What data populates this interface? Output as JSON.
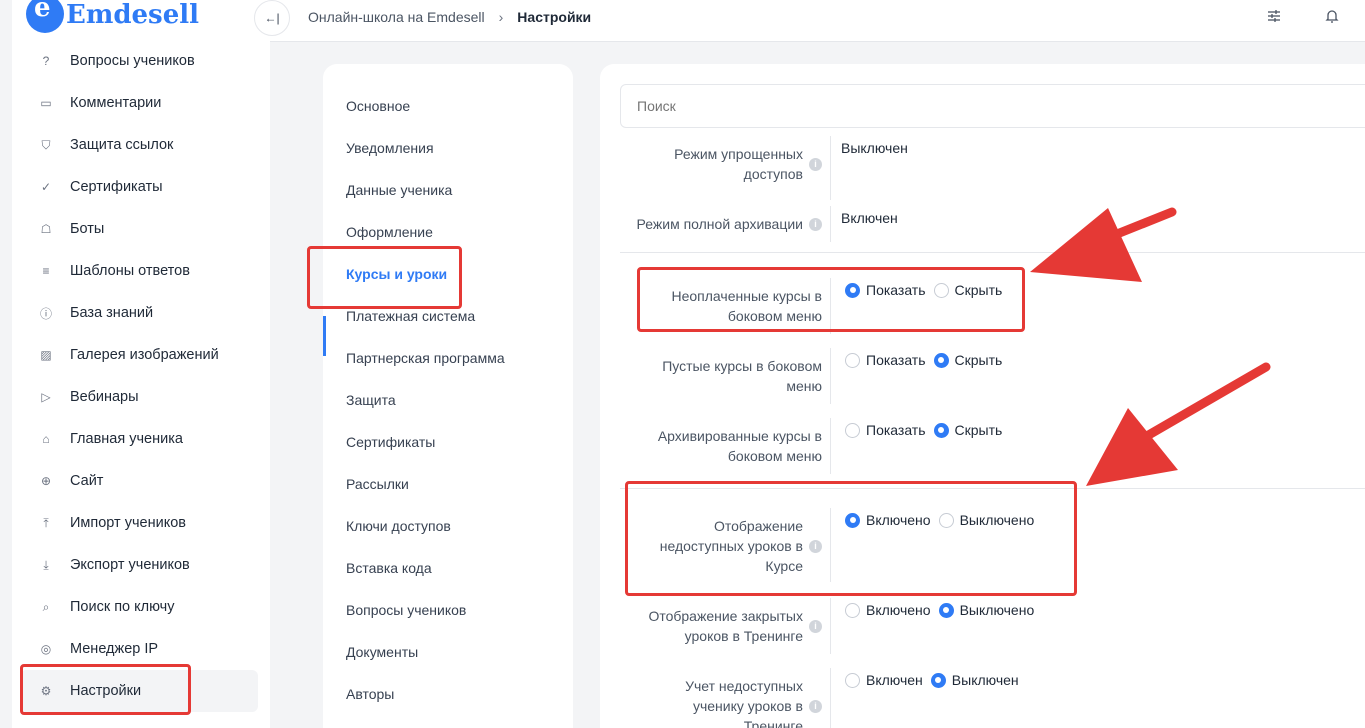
{
  "brand": {
    "logo_letter": "e",
    "name": "Emdesell"
  },
  "sidebar": {
    "items": [
      {
        "label": "Вопросы учеников",
        "icon": "question-circle-icon",
        "glyph": "?"
      },
      {
        "label": "Комментарии",
        "icon": "comment-icon",
        "glyph": "▭"
      },
      {
        "label": "Защита ссылок",
        "icon": "shield-icon",
        "glyph": "⛉"
      },
      {
        "label": "Сертификаты",
        "icon": "certificate-icon",
        "glyph": "✓"
      },
      {
        "label": "Боты",
        "icon": "bot-icon",
        "glyph": "☖"
      },
      {
        "label": "Шаблоны ответов",
        "icon": "list-icon",
        "glyph": "≡"
      },
      {
        "label": "База знаний",
        "icon": "info-icon",
        "glyph": "ⓘ"
      },
      {
        "label": "Галерея изображений",
        "icon": "image-icon",
        "glyph": "▨"
      },
      {
        "label": "Вебинары",
        "icon": "play-icon",
        "glyph": "▷"
      },
      {
        "label": "Главная ученика",
        "icon": "home-icon",
        "glyph": "⌂"
      },
      {
        "label": "Сайт",
        "icon": "globe-icon",
        "glyph": "⊕"
      },
      {
        "label": "Импорт учеников",
        "icon": "upload-icon",
        "glyph": "⤒"
      },
      {
        "label": "Экспорт учеников",
        "icon": "download-icon",
        "glyph": "⤓"
      },
      {
        "label": "Поиск по ключу",
        "icon": "search-icon",
        "glyph": "⌕"
      },
      {
        "label": "Менеджер IP",
        "icon": "target-icon",
        "glyph": "◎"
      },
      {
        "label": "Настройки",
        "icon": "gear-icon",
        "glyph": "⚙",
        "active": true
      }
    ]
  },
  "header": {
    "collapse_glyph": "←|",
    "breadcrumb": {
      "parent": "Онлайн-школа на Emdesell",
      "separator": "›",
      "current": "Настройки"
    },
    "filter_icon_glyph": "☰",
    "bell_icon_glyph": "🔔"
  },
  "settings_nav": {
    "items": [
      "Основное",
      "Уведомления",
      "Данные ученика",
      "Оформление",
      "Курсы и уроки",
      "Платежная система",
      "Партнерская программа",
      "Защита",
      "Сертификаты",
      "Рассылки",
      "Ключи доступов",
      "Вставка кода",
      "Вопросы учеников",
      "Документы",
      "Авторы"
    ],
    "active_index": 4
  },
  "main": {
    "search_placeholder": "Поиск",
    "rows": [
      {
        "label_lines": [
          "Режим упрощенных",
          "доступов"
        ],
        "info": true,
        "type": "text",
        "value": "Выключен"
      },
      {
        "label_lines": [
          "Режим полной архивации"
        ],
        "info": true,
        "type": "text",
        "value": "Включен"
      },
      {
        "label_lines": [
          "Неоплаченные курсы в",
          "боковом меню"
        ],
        "info": false,
        "type": "radio",
        "options": [
          "Показать",
          "Скрыть"
        ],
        "selected": 0
      },
      {
        "label_lines": [
          "Пустые курсы в боковом",
          "меню"
        ],
        "info": false,
        "type": "radio",
        "options": [
          "Показать",
          "Скрыть"
        ],
        "selected": 1
      },
      {
        "label_lines": [
          "Архивированные курсы в",
          "боковом меню"
        ],
        "info": false,
        "type": "radio",
        "options": [
          "Показать",
          "Скрыть"
        ],
        "selected": 1
      },
      {
        "label_lines": [
          "Отображение",
          "недоступных уроков в",
          "Курсе"
        ],
        "info": true,
        "type": "radio",
        "options": [
          "Включено",
          "Выключено"
        ],
        "selected": 0
      },
      {
        "label_lines": [
          "Отображение закрытых",
          "уроков в Тренинге"
        ],
        "info": true,
        "type": "radio",
        "options": [
          "Включено",
          "Выключено"
        ],
        "selected": 1
      },
      {
        "label_lines": [
          "Учет недоступных",
          "ученику уроков в",
          "Тренинге"
        ],
        "info": true,
        "type": "radio",
        "options": [
          "Включен",
          "Выключен"
        ],
        "selected": 1
      }
    ]
  },
  "colors": {
    "accent": "#2f7bf5",
    "annotation_red": "#e53935"
  }
}
